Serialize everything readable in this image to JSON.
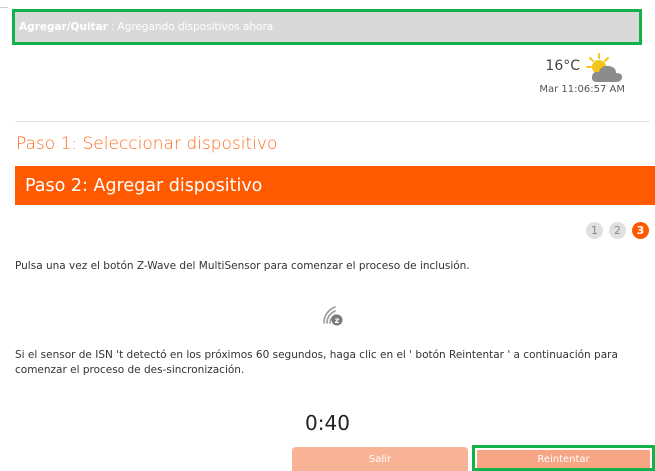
{
  "breadcrumb": {
    "section": "Agregar/Quitar",
    "separator": ":",
    "status": "Agregando dispositivos ahora"
  },
  "weather": {
    "temperature": "16°C",
    "icon": "partly-cloudy-icon",
    "datetime": "Mar 11:06:57 AM"
  },
  "steps": {
    "step1_label": "Paso 1: Seleccionar dispositivo",
    "step2_label": "Paso 2: Agregar dispositivo"
  },
  "stepper": {
    "items": [
      "1",
      "2",
      "3"
    ],
    "active_index": 2
  },
  "content": {
    "instruction": "Pulsa una vez el botón Z-Wave del MultiSensor para comenzar el proceso de inclusión.",
    "icon": "z-wave-icon",
    "retry_note": "Si el sensor de ISN 't detectó en los próximos 60 segundos, haga clic en el ' botón Reintentar ' a continuación para comenzar el proceso de des-sincronización.",
    "timer": "0:40"
  },
  "buttons": {
    "exit_label": "Salir",
    "retry_label": "Reintentar"
  },
  "colors": {
    "accent": "#ff5a00",
    "highlight": "#14b04a"
  }
}
